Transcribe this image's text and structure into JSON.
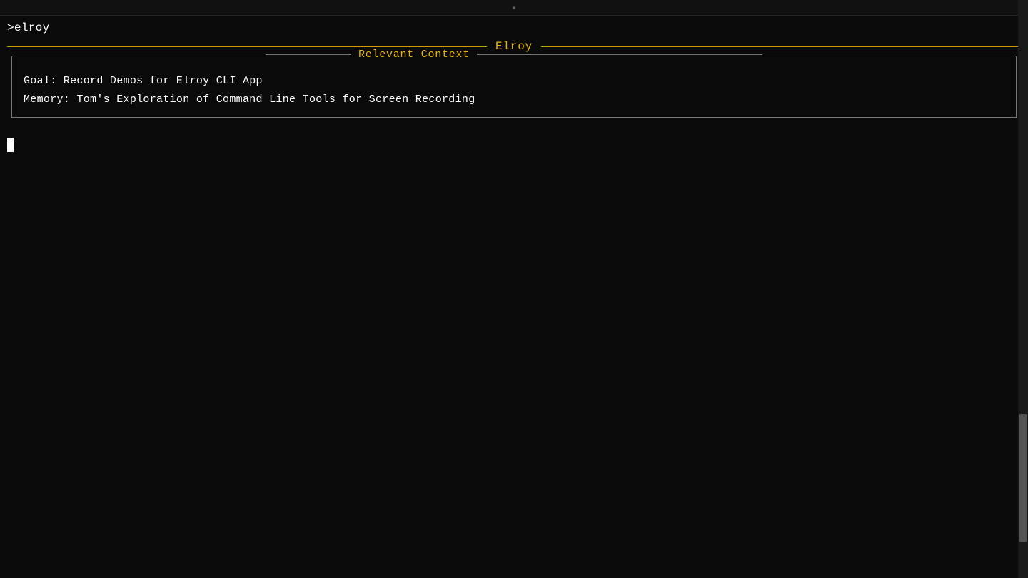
{
  "terminal": {
    "title_bar_dot": "·",
    "command_prompt": ">elroy",
    "elroy_header_title": "Elroy",
    "relevant_context_label": "Relevant Context",
    "goal_line": "Goal: Record Demos for Elroy CLI App",
    "memory_line": "Memory: Tom's Exploration of Command Line Tools for Screen Recording",
    "colors": {
      "background": "#0a0a0a",
      "text_primary": "#ffffff",
      "accent_yellow": "#e8b800",
      "border_color": "#777777",
      "scrollbar_bg": "#1a1a1a",
      "scrollbar_thumb": "#555555"
    }
  }
}
